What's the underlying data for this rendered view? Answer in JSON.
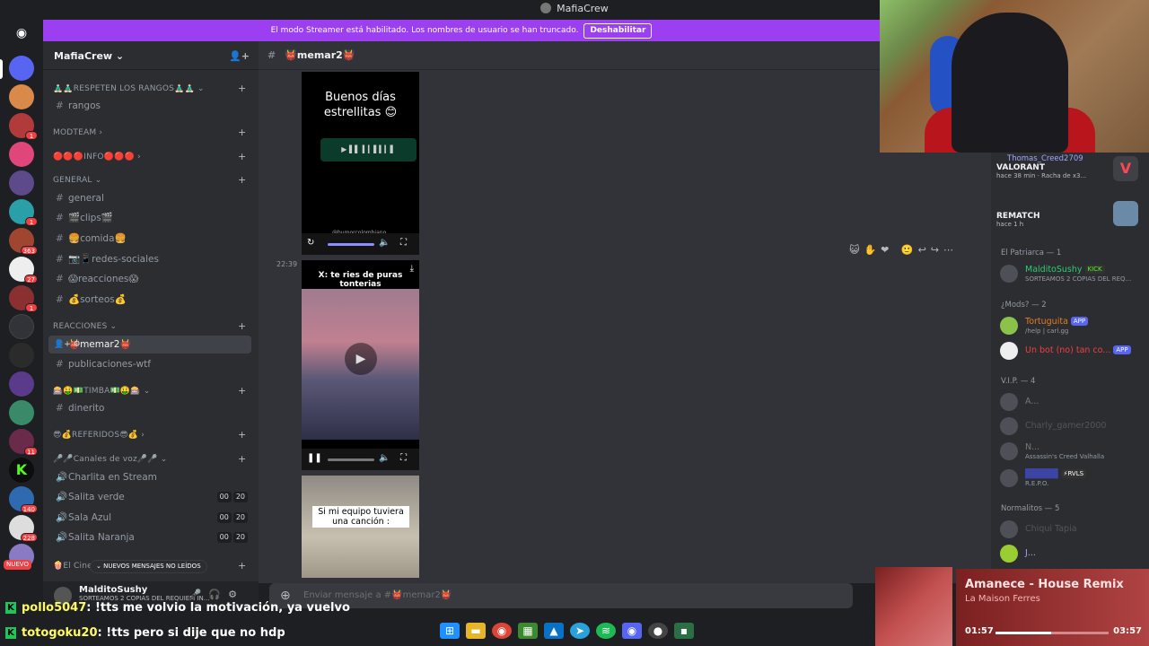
{
  "window": {
    "title": "MafiaCrew"
  },
  "banner": {
    "text": "El modo Streamer está habilitado. Los nombres de usuario se han truncado.",
    "button": "Deshabilitar"
  },
  "rail": {
    "badges": [
      "1",
      "1",
      "363",
      "27",
      "1",
      "11",
      "140",
      "228"
    ],
    "nuevo": "NUEVO"
  },
  "guild": {
    "name": "MafiaCrew ⌄"
  },
  "sidebar": {
    "cat_respeten": "🧘🏻‍♂️🧘🏻‍♂️RESPETEN LOS RANGOS🧘🏻‍♂️🧘🏻‍♂️ ⌄",
    "ch_rangos": "rangos",
    "cat_modteam": "MODTEAM ›",
    "cat_info": "🔴🔴🔴INFO🔴🔴🔴 ›",
    "cat_general": "GENERAL ⌄",
    "ch_general": "general",
    "ch_clips": "🎬clips🎬",
    "ch_comida": "🍔comida🍔",
    "ch_redes": "📷📱redes-sociales",
    "ch_reacciones": "😱reacciones😱",
    "ch_sorteos": "💰sorteos💰",
    "cat_reacciones": "REACCIONES ⌄",
    "ch_memar2": "👹memar2👹",
    "ch_publicaciones": "publicaciones-wtf",
    "cat_timba": "🎰🤑💵TIMBA💵🤑🎰 ⌄",
    "ch_dinerito": "dinerito",
    "cat_referidos": "😎💰REFERIDOS😎💰 ›",
    "cat_voz": "🎤🎤Canales de voz🎤🎤 ⌄",
    "v_charlita": "Charlita en Stream",
    "v_verde": "Salita verde",
    "v_azul": "Sala Azul",
    "v_naranja": "Salita Naranja",
    "v_cine": "🍿El Cine",
    "count_a": "00",
    "count_b": "20"
  },
  "new_messages": "⌄ NUEVOS MENSAJES NO LEÍDOS",
  "user": {
    "name": "MalditoSushy",
    "status": "SORTEAMOS 2 COPIAS DEL REQUIEM IN..."
  },
  "channel": {
    "name": "👹memar2👹"
  },
  "messages": {
    "video1_text": "Buenos días estrellitas 😊",
    "video1_handle": "@humorcolombiano",
    "timestamp": "22:39",
    "video2_caption": "X: te ries de puras tonterias",
    "video3_caption": "Si mi equipo tuviera una canción :"
  },
  "composer": {
    "placeholder": "Enviar mensaje a #👹memar2👹"
  },
  "members": {
    "act1_user": "Thomas_Creed2709",
    "act1_title": "VALORANT",
    "act1_sub": "hace 38 min · Racha de x3...",
    "act2_title": "REMATCH",
    "act2_sub": "hace 1 h",
    "cat_patriarca": "El Patriarca — 1",
    "m1_name": "MalditoSushy",
    "m1_tag": "KICK",
    "m1_status": "SORTEAMOS 2 COPIAS DEL REQ...",
    "cat_mods": "¿Mods? — 2",
    "m2_name": "Tortuguita",
    "m2_tag": "APP",
    "m2_status": "/help | carl.gg",
    "m3_name": "Un bot (no) tan co...",
    "m3_tag": "APP",
    "cat_vip": "V.I.P. — 4",
    "m4_name": "A...",
    "m5_name": "Charly_gamer2000",
    "m6_name": "N...",
    "m6_status": "Assassin's Creed Valhalla",
    "m7_tag": "⚡RVLS",
    "m7_status": "R.E.P.O.",
    "cat_normalitos": "Normalitos — 5",
    "m8_name": "Chiqui Tapia",
    "m9_name": "J..."
  },
  "chat": [
    {
      "user": "pollo5047",
      "text": ": !tts me volvio la motivación, ya vuelvo"
    },
    {
      "user": "totogoku20",
      "text": ": !tts pero si dije que no hdp"
    }
  ],
  "music": {
    "title": "Amanece - House Remix",
    "artist": "La Maison Ferres",
    "elapsed": "01:57",
    "total": "03:57",
    "progress": 0.49
  }
}
